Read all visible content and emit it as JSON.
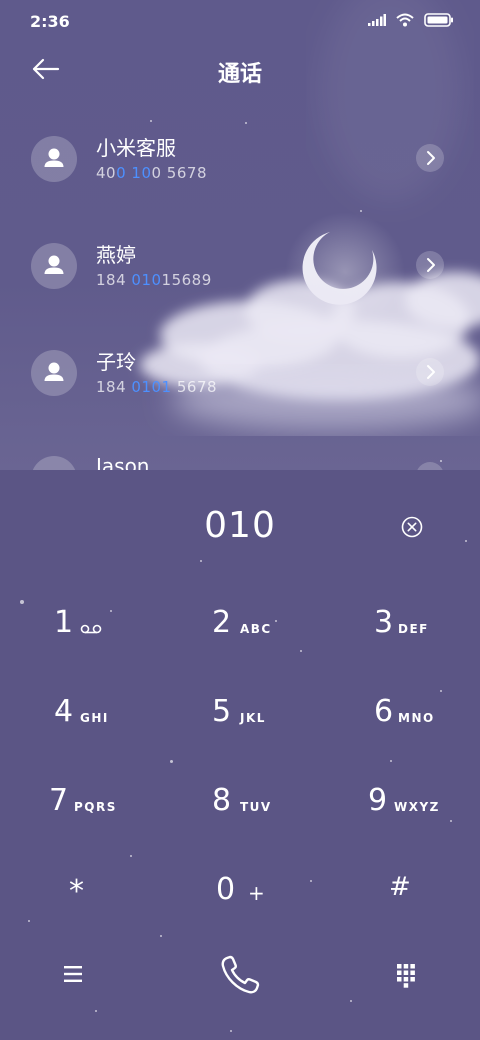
{
  "status_bar": {
    "time": "2:36",
    "icons": [
      "signal-icon",
      "wifi-icon",
      "battery-icon"
    ]
  },
  "header": {
    "title": "通话",
    "back_icon": "arrow-left-icon"
  },
  "contacts": [
    {
      "name": "小米客服",
      "number_parts": [
        "40",
        "0 10",
        "0 5678"
      ]
    },
    {
      "name": "燕婷",
      "number_parts": [
        "184 ",
        "010",
        "15689"
      ]
    },
    {
      "name": "子玲",
      "number_parts": [
        "184 ",
        "0101",
        " 5678"
      ]
    },
    {
      "name": "Jason"
    }
  ],
  "dialer": {
    "input": "010",
    "clear_icon": "clear-circle-icon",
    "keys": [
      {
        "digit": "1",
        "letters": "",
        "icon": "voicemail-icon"
      },
      {
        "digit": "2",
        "letters": "ABC"
      },
      {
        "digit": "3",
        "letters": "DEF"
      },
      {
        "digit": "4",
        "letters": "GHI"
      },
      {
        "digit": "5",
        "letters": "JKL"
      },
      {
        "digit": "6",
        "letters": "MNO"
      },
      {
        "digit": "7",
        "letters": "PQRS"
      },
      {
        "digit": "8",
        "letters": "TUV"
      },
      {
        "digit": "9",
        "letters": "WXYZ"
      },
      {
        "digit": "*",
        "letters": ""
      },
      {
        "digit": "0",
        "letters": "+"
      },
      {
        "digit": "#",
        "letters": ""
      }
    ]
  },
  "bottom_bar": {
    "icons": [
      "menu-icon",
      "call-icon",
      "dialpad-icon"
    ]
  },
  "colors": {
    "background": "#5b5585",
    "highlight": "#4d90ff"
  }
}
